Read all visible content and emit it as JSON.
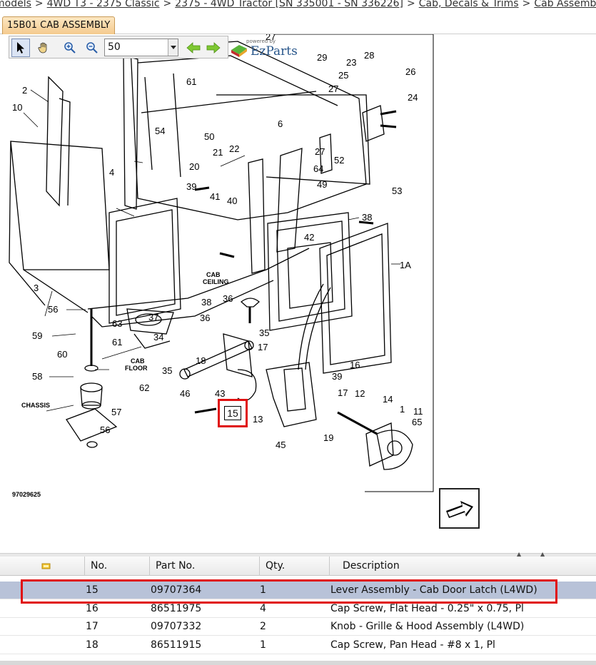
{
  "breadcrumb": [
    {
      "label": "models"
    },
    {
      "label": "4WD T3 - 2375 Classic"
    },
    {
      "label": "2375 - 4WD Tractor [SN 335001 - SN 336226]"
    },
    {
      "label": "Cab, Decals & Trims"
    },
    {
      "label": "Cab Assembly"
    }
  ],
  "breadcrumb_separator": ">",
  "tab": {
    "label": "15B01 CAB ASSEMBLY"
  },
  "toolbar": {
    "zoom_value": "50",
    "icons": [
      "pointer-icon",
      "hand-icon",
      "zoom-in-icon",
      "zoom-out-icon",
      "arrow-left-icon",
      "arrow-right-icon"
    ]
  },
  "brand": {
    "small": "powered by",
    "name": "EzParts"
  },
  "diagram": {
    "callouts": [
      "2",
      "10",
      "3",
      "54",
      "4",
      "61",
      "50",
      "6",
      "20",
      "21",
      "22",
      "39",
      "41",
      "40",
      "29",
      "23",
      "28",
      "25",
      "26",
      "27",
      "24",
      "27",
      "52",
      "64",
      "49",
      "53",
      "38",
      "42",
      "1A",
      "56",
      "37",
      "38",
      "36",
      "36",
      "63",
      "59",
      "61",
      "34",
      "35",
      "18",
      "17",
      "16",
      "39",
      "60",
      "58",
      "62",
      "35",
      "46",
      "43",
      "12",
      "17",
      "13",
      "19",
      "45",
      "14",
      "1",
      "11",
      "65",
      "57",
      "56",
      "27"
    ],
    "labels": {
      "cab_ceiling_1": "CAB",
      "cab_ceiling_2": "CEILING",
      "cab_floor_1": "CAB",
      "cab_floor_2": "FLOOR",
      "chassis": "CHASSIS",
      "drawing_number": "97029625"
    },
    "highlight_callout": "15"
  },
  "table": {
    "headers": {
      "no": "No.",
      "part_no": "Part No.",
      "qty": "Qty.",
      "description": "Description"
    },
    "rows": [
      {
        "no": "15",
        "part_no": "09707364",
        "qty": "1",
        "description": "Lever Assembly - Cab Door Latch (L4WD)",
        "selected": true
      },
      {
        "no": "16",
        "part_no": "86511975",
        "qty": "4",
        "description": "Cap Screw, Flat Head - 0.25\" x 0.75, Pl",
        "selected": false
      },
      {
        "no": "17",
        "part_no": "09707332",
        "qty": "2",
        "description": "Knob - Grille & Hood Assembly (L4WD)",
        "selected": false
      },
      {
        "no": "18",
        "part_no": "86511915",
        "qty": "1",
        "description": "Cap Screw, Pan Head - #8 x 1, Pl",
        "selected": false
      }
    ]
  },
  "colors": {
    "highlight": "#e01010",
    "selected_row": "#b8c2d8",
    "tab": "#f4c98c"
  }
}
